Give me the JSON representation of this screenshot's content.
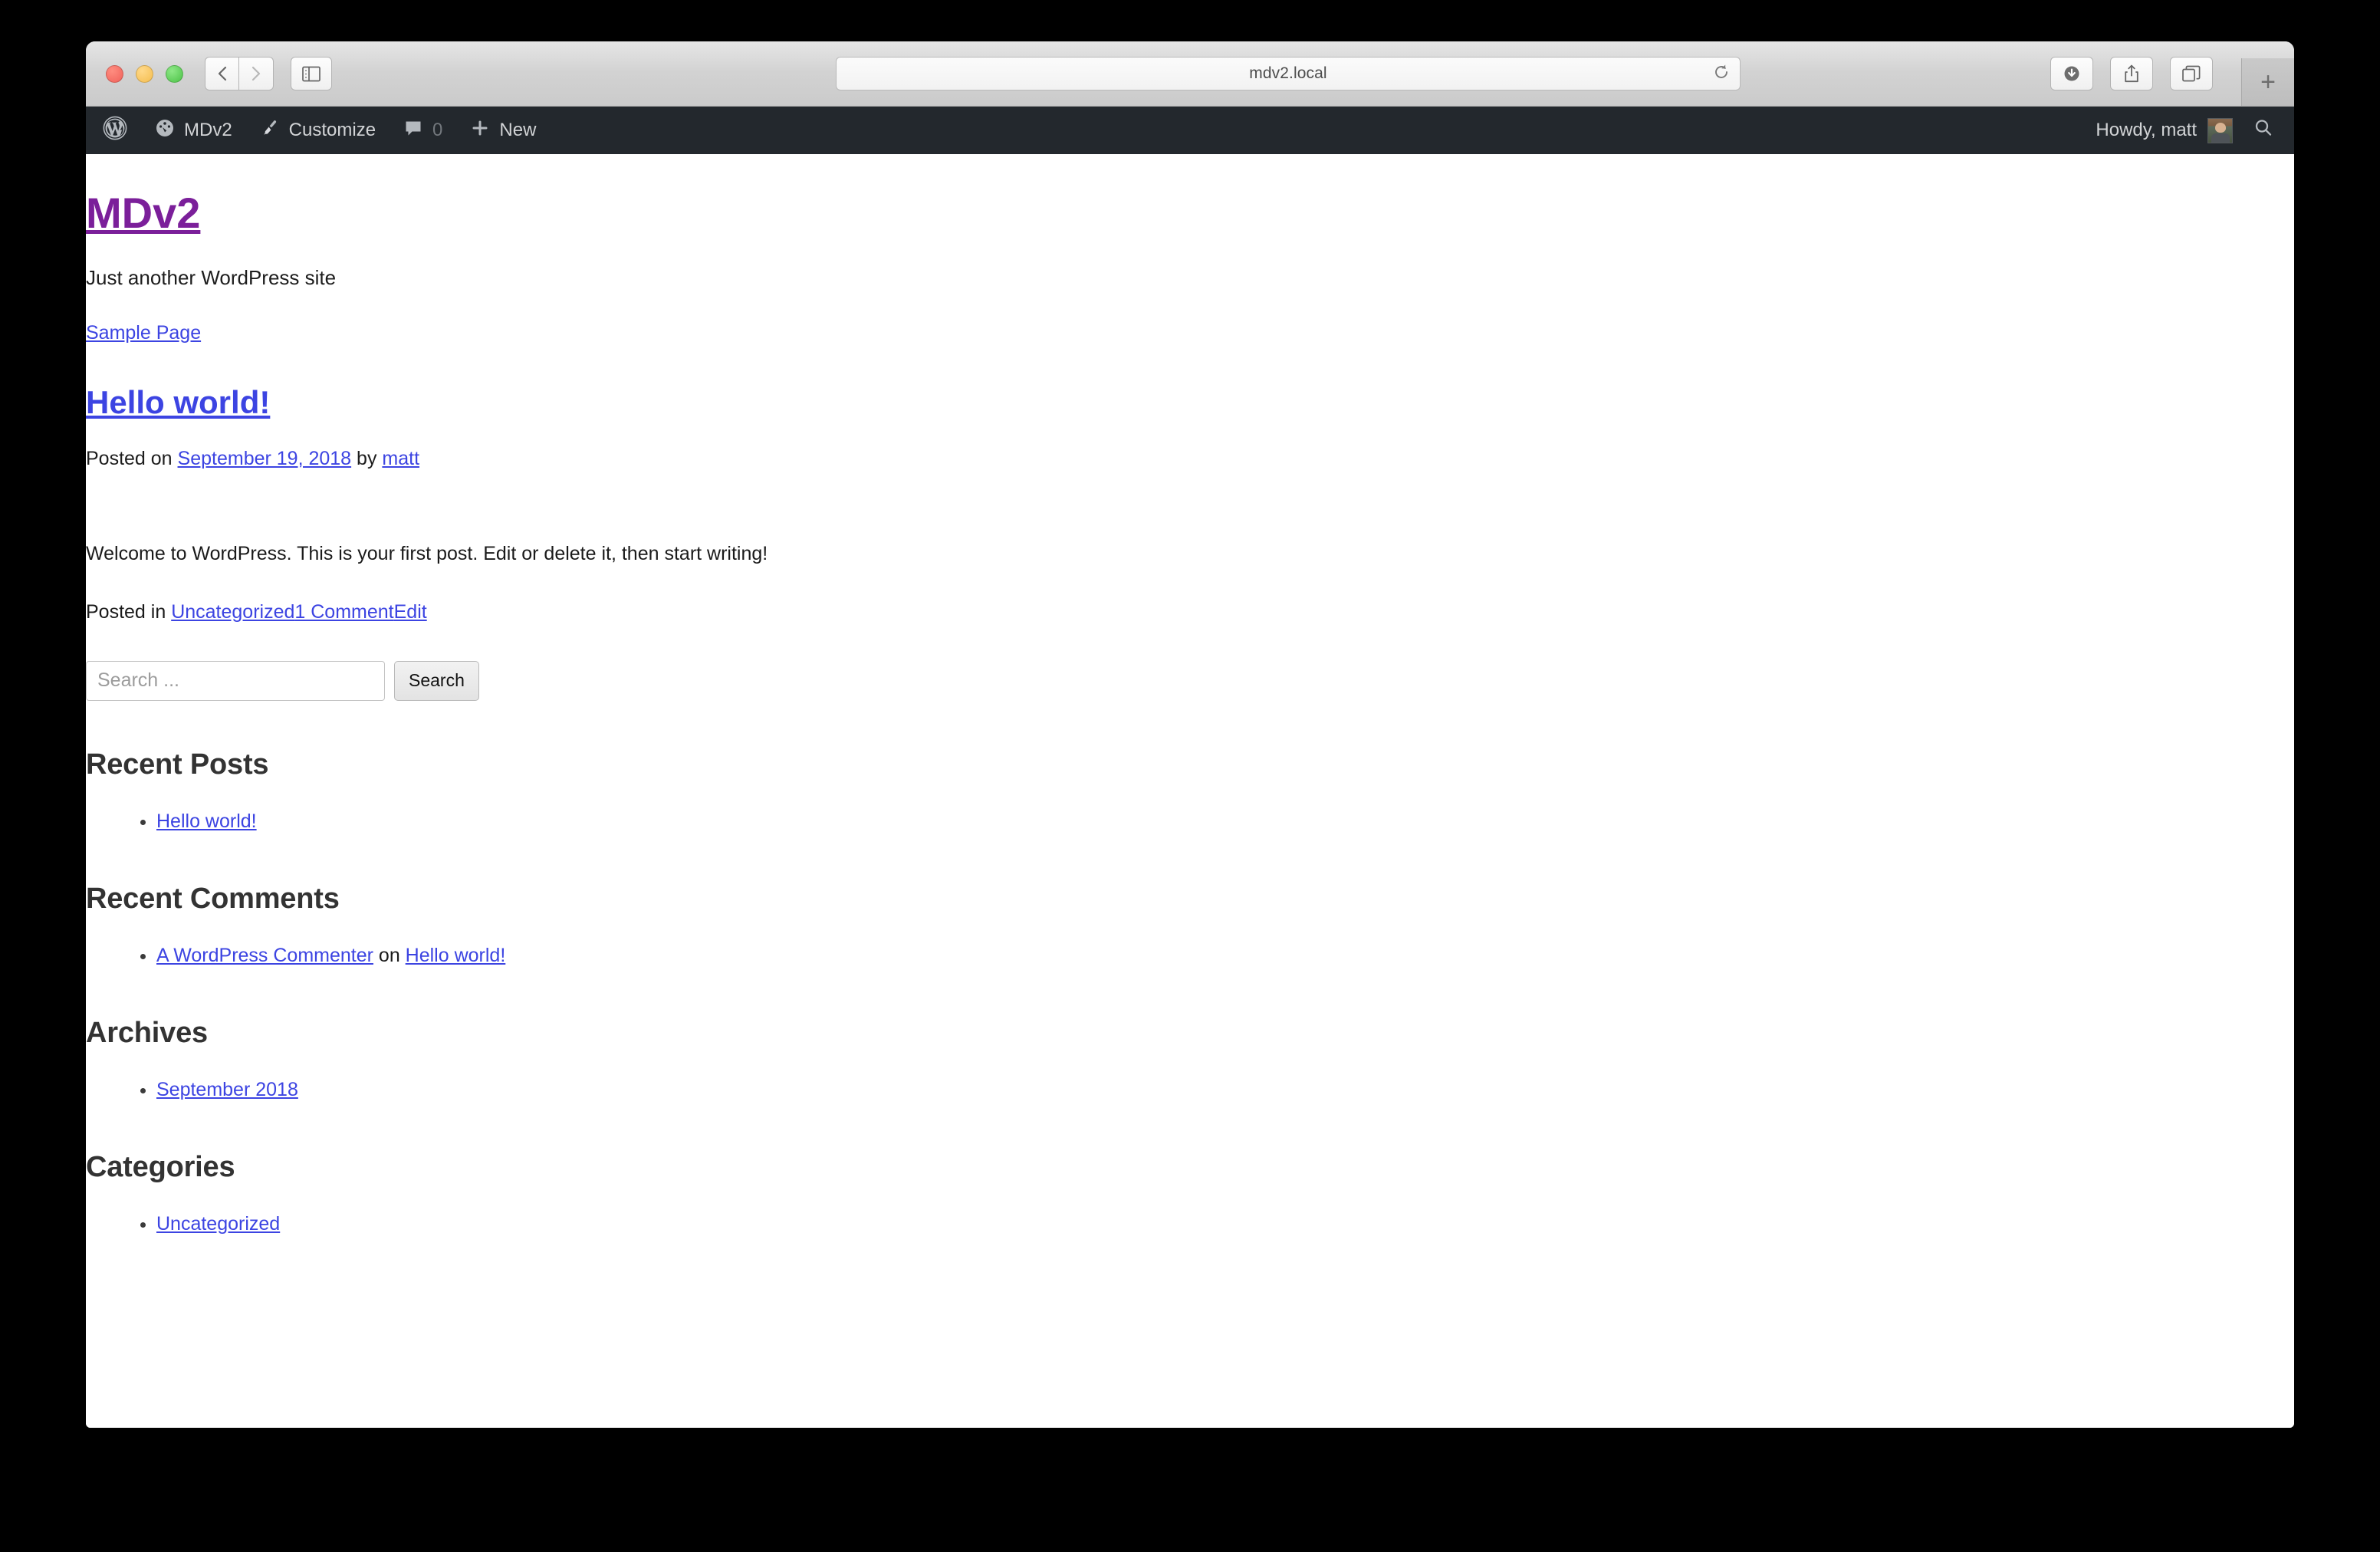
{
  "browser": {
    "url": "mdv2.local",
    "nav_back_icon": "chevron-left-icon",
    "nav_forward_icon": "chevron-right-icon",
    "sidebar_icon": "sidebar-toggle-icon",
    "reload_icon": "reload-icon",
    "downloads_icon": "downloads-icon",
    "share_icon": "share-icon",
    "tabs_icon": "show-tabs-icon",
    "new_tab_label": "+"
  },
  "adminbar": {
    "logo_icon": "wordpress-logo-icon",
    "items": [
      {
        "icon": "dashboard-icon",
        "label": "MDv2"
      },
      {
        "icon": "customize-brush-icon",
        "label": "Customize"
      },
      {
        "icon": "comment-bubble-icon",
        "label": "0"
      },
      {
        "icon": "plus-icon",
        "label": "New"
      }
    ],
    "howdy": "Howdy, matt",
    "avatar_alt": "matt",
    "search_icon": "search-icon"
  },
  "site": {
    "title": "MDv2",
    "tagline": "Just another WordPress site",
    "menu": [
      {
        "label": "Sample Page"
      }
    ]
  },
  "post": {
    "title": "Hello world!",
    "meta_prefix": "Posted on ",
    "date": "September 19, 2018",
    "meta_by": " by ",
    "author": "matt",
    "content": "Welcome to WordPress. This is your first post. Edit or delete it, then start writing!",
    "footer_prefix": "Posted in ",
    "category": "Uncategorized",
    "comments": "1 Comment",
    "edit": "Edit"
  },
  "search": {
    "placeholder": "Search ...",
    "value": "",
    "submit_label": "Search"
  },
  "widgets": {
    "recent_posts": {
      "title": "Recent Posts",
      "items": [
        {
          "label": "Hello world!"
        }
      ]
    },
    "recent_comments": {
      "title": "Recent Comments",
      "items": [
        {
          "author": "A WordPress Commenter",
          "on": " on ",
          "post": "Hello world!"
        }
      ]
    },
    "archives": {
      "title": "Archives",
      "items": [
        {
          "label": "September 2018"
        }
      ]
    },
    "categories": {
      "title": "Categories",
      "items": [
        {
          "label": "Uncategorized"
        }
      ]
    }
  },
  "colors": {
    "adminbar_bg": "#23282d",
    "link": "#3c44e2",
    "visited_link": "#7b1f9a",
    "heading": "#333333",
    "page_bg": "#ffffff"
  }
}
